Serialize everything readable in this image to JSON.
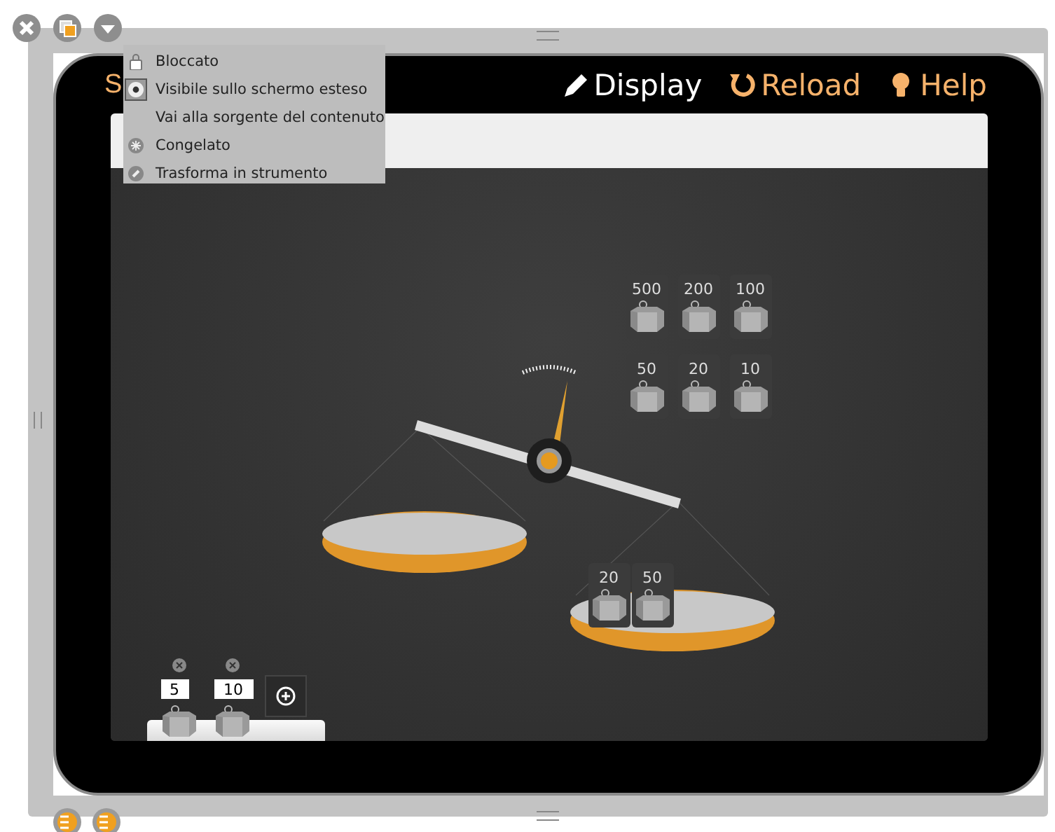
{
  "app": {
    "title": "S",
    "toolbar": [
      {
        "label": "Display",
        "kind": "pencil",
        "color": "#ffffff"
      },
      {
        "label": "Reload",
        "kind": "reload",
        "color": "#f6b26b"
      },
      {
        "label": "Help",
        "kind": "bulb",
        "color": "#f6b26b"
      }
    ]
  },
  "menu": {
    "items": [
      {
        "label": "Bloccato",
        "kind": "lock",
        "checked": false
      },
      {
        "label": "Visibile sullo schermo esteso",
        "kind": "eye",
        "checked": true
      },
      {
        "label": "Vai alla sorgente del contenuto",
        "kind": "plain",
        "checked": false
      },
      {
        "label": "Congelato",
        "kind": "freeze",
        "checked": false
      },
      {
        "label": "Trasforma in strumento",
        "kind": "tool",
        "checked": false
      }
    ]
  },
  "weight_box": [
    {
      "label": "500"
    },
    {
      "label": "200"
    },
    {
      "label": "100"
    },
    {
      "label": "50"
    },
    {
      "label": "20"
    },
    {
      "label": "10"
    }
  ],
  "right_pan": [
    {
      "label": "20"
    },
    {
      "label": "50"
    }
  ],
  "custom_weights": [
    {
      "value": "5"
    },
    {
      "value": "10"
    }
  ]
}
